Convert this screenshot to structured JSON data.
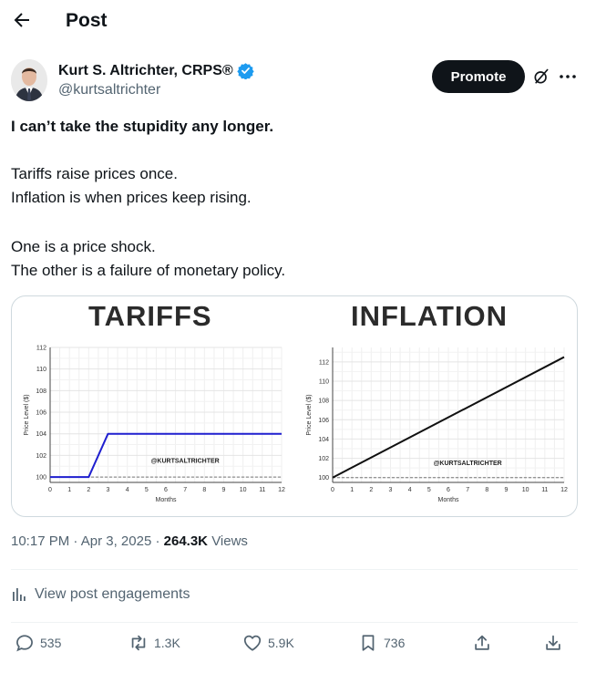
{
  "header": {
    "title": "Post"
  },
  "author": {
    "name": "Kurt S. Altrichter, CRPS®",
    "handle": "@kurtsaltrichter"
  },
  "buttons": {
    "promote": "Promote"
  },
  "post": {
    "line1": "I can’t take the stupidity any longer.",
    "line2": "Tariffs raise prices once.",
    "line3": "Inflation is when prices keep rising.",
    "line4": "One is a price shock.",
    "line5": "The other is a failure of monetary policy."
  },
  "meta": {
    "time": "10:17 PM",
    "date": "Apr 3, 2025",
    "views_count": "264.3K",
    "views_label": "Views"
  },
  "engagements_label": "View post engagements",
  "actions": {
    "replies": "535",
    "reposts": "1.3K",
    "likes": "5.9K",
    "bookmarks": "736"
  },
  "colors": {
    "verified": "#1d9bf0",
    "promote_bg": "#0f1419",
    "muted": "#536471",
    "tariff_line": "#1f1fcf",
    "inflation_line": "#111111"
  },
  "chart_data": [
    {
      "type": "line",
      "title": "TARIFFS",
      "xlabel": "Months",
      "ylabel": "Price Level ($)",
      "x": [
        0,
        1,
        2,
        3,
        4,
        5,
        6,
        7,
        8,
        9,
        10,
        11,
        12
      ],
      "series": [
        {
          "values": [
            100,
            100,
            100,
            104,
            104,
            104,
            104,
            104,
            104,
            104,
            104,
            104,
            104
          ]
        }
      ],
      "xticks": [
        "0",
        "1",
        "2",
        "3",
        "4",
        "5",
        "6",
        "7",
        "8",
        "9",
        "10",
        "11",
        "12"
      ],
      "yticks": [
        "100",
        "102",
        "104",
        "106",
        "108",
        "110",
        "112"
      ],
      "ylim": [
        99.5,
        112
      ],
      "baseline": 100,
      "watermark": "@KURTSALTRICHTER",
      "grid": true
    },
    {
      "type": "line",
      "title": "INFLATION",
      "xlabel": "Months",
      "ylabel": "Price Level ($)",
      "x": [
        0,
        12
      ],
      "series": [
        {
          "values": [
            100,
            112.5
          ]
        }
      ],
      "xticks": [
        "0",
        "1",
        "2",
        "3",
        "4",
        "5",
        "6",
        "7",
        "8",
        "9",
        "10",
        "11",
        "12"
      ],
      "yticks": [
        "100",
        "102",
        "104",
        "106",
        "108",
        "110",
        "112"
      ],
      "ylim": [
        99.5,
        113.5
      ],
      "baseline": 100,
      "watermark": "@KURTSALTRICHTER",
      "grid": true
    }
  ]
}
